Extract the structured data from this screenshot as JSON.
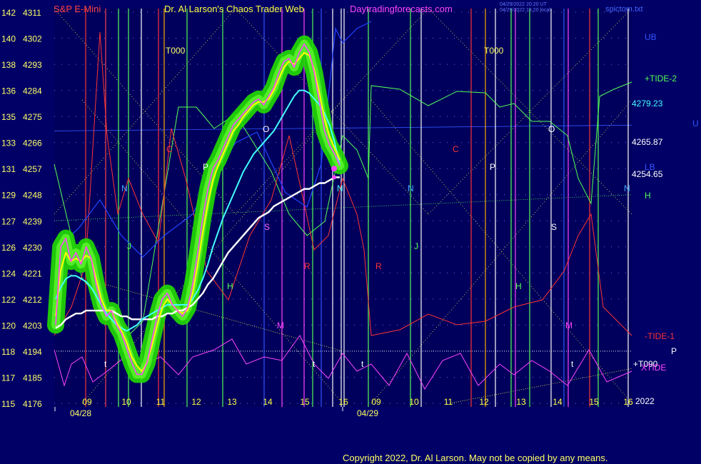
{
  "header": {
    "instrument": "S&P E-Mini",
    "site": "Dr. Al Larson's Chaos Trader Web",
    "url": "Daytradingforecasts.com",
    "stamp1": "04/29/2022 20:20 UT",
    "stamp2": "04/29/2022 15:20 local",
    "filename": "spictom.txt"
  },
  "footer": {
    "copyright": "Copyright 2022, Dr. Al Larson. May not be copied by any means."
  },
  "colors": {
    "background": "#000066",
    "plot_bg": "#00005c",
    "price_bar": "#ff44ff",
    "yellow_avg": "#ffff00",
    "cyan_avg": "#44ffff",
    "white_avg": "#ffffff",
    "glow": "#22dd00",
    "tide_plus": "#55ff55",
    "tide_minus": "#ff3333",
    "xtide": "#ff44ff",
    "blue_band": "#2244ff",
    "grid_dots": "#6666ff"
  },
  "chart_data": {
    "type": "line",
    "title": "S&P E-Mini",
    "dates": [
      "04/28",
      "04/29"
    ],
    "y_left_labels": [
      {
        "idx": "142",
        "price": "4311"
      },
      {
        "idx": "140",
        "price": "4302"
      },
      {
        "idx": "138",
        "price": "4293"
      },
      {
        "idx": "136",
        "price": "4284"
      },
      {
        "idx": "135",
        "price": "4275"
      },
      {
        "idx": "133",
        "price": "4266"
      },
      {
        "idx": "131",
        "price": "4257"
      },
      {
        "idx": "129",
        "price": "4248"
      },
      {
        "idx": "127",
        "price": "4239"
      },
      {
        "idx": "126",
        "price": "4230"
      },
      {
        "idx": "124",
        "price": "4221"
      },
      {
        "idx": "122",
        "price": "4212"
      },
      {
        "idx": "120",
        "price": "4203"
      },
      {
        "idx": "118",
        "price": "4194"
      },
      {
        "idx": "117",
        "price": "4185"
      },
      {
        "idx": "115",
        "price": "4176"
      }
    ],
    "ylim": [
      4176,
      4311
    ],
    "x_tick_labels": [
      "09",
      "10",
      "11",
      "12",
      "13",
      "14",
      "15",
      "16",
      "09",
      "10",
      "11",
      "12",
      "13",
      "14",
      "15",
      "16"
    ],
    "right_labels": [
      {
        "text": "UB",
        "color": "#3355ff"
      },
      {
        "text": "+TIDE-2",
        "color": "#55ff55"
      },
      {
        "text": "4279.23",
        "color": "#44ffff"
      },
      {
        "text": "U",
        "color": "#3355ff"
      },
      {
        "text": "4265.87",
        "color": "#ffffff"
      },
      {
        "text": "LB",
        "color": "#3355ff"
      },
      {
        "text": "4254.65",
        "color": "#ffffff"
      },
      {
        "text": "H",
        "color": "#55ff55"
      },
      {
        "text": "-TIDE-1",
        "color": "#ff3333"
      },
      {
        "text": "P",
        "color": "#ffffff"
      },
      {
        "text": "+T090",
        "color": "#ffffff"
      },
      {
        "text": "XTIDE",
        "color": "#ff44ff"
      },
      {
        "text": "2022",
        "color": "#ffffff"
      }
    ],
    "time_markers": [
      "T000",
      "T000"
    ],
    "annotations": [
      "N",
      "N",
      "N",
      "N",
      "P",
      "P",
      "O",
      "O",
      "S",
      "S",
      "J",
      "J",
      "H",
      "H",
      "M",
      "M",
      "R",
      "R",
      "C",
      "C",
      "t",
      "t",
      "t",
      "t"
    ],
    "series": [
      {
        "name": "price",
        "values": [
          4203,
          4230,
          4233,
          4225,
          4228,
          4224,
          4230,
          4226,
          4217,
          4210,
          4206,
          4208,
          4203,
          4200,
          4195,
          4190,
          4186,
          4186,
          4190,
          4198,
          4206,
          4212,
          4214,
          4210,
          4208,
          4206,
          4209,
          4217,
          4228,
          4240,
          4250,
          4257,
          4260,
          4264,
          4268,
          4272,
          4274,
          4276,
          4278,
          4280,
          4281,
          4279,
          4282,
          4285,
          4290,
          4294,
          4295,
          4292,
          4297,
          4300,
          4297,
          4290,
          4280,
          4270,
          4265,
          4262,
          4258
        ]
      },
      {
        "name": "fast-average",
        "values": [
          4206,
          4222,
          4228,
          4225,
          4226,
          4225,
          4227,
          4226,
          4219,
          4212,
          4208,
          4208,
          4204,
          4201,
          4197,
          4192,
          4189,
          4187,
          4190,
          4196,
          4203,
          4209,
          4212,
          4210,
          4208,
          4207,
          4208,
          4214,
          4224,
          4235,
          4245,
          4253,
          4258,
          4262,
          4266,
          4270,
          4272,
          4275,
          4277,
          4279,
          4280,
          4280,
          4281,
          4284,
          4288,
          4292,
          4294,
          4293,
          4295,
          4297,
          4296,
          4291,
          4283,
          4274,
          4268,
          4264,
          4260
        ]
      },
      {
        "name": "medium-average",
        "values": [
          4212,
          4216,
          4219,
          4220,
          4220,
          4219,
          4218,
          4216,
          4213,
          4210,
          4207,
          4205,
          4203,
          4202,
          4201,
          4202,
          4203,
          4205,
          4206,
          4207,
          4208,
          4209,
          4210,
          4210,
          4210,
          4210,
          4210,
          4212,
          4215,
          4219,
          4224,
          4230,
          4235,
          4240,
          4244,
          4248,
          4252,
          4256,
          4259,
          4262,
          4264,
          4266,
          4268,
          4270,
          4273,
          4276,
          4279,
          4282,
          4284,
          4284,
          4283,
          4281,
          4279,
          4276,
          4272,
          4266,
          4258
        ]
      },
      {
        "name": "slow-average",
        "values": [
          4202,
          4203,
          4205,
          4206,
          4207,
          4207,
          4208,
          4208,
          4208,
          4208,
          4208,
          4208,
          4207,
          4206,
          4206,
          4205,
          4205,
          4205,
          4205,
          4205,
          4206,
          4206,
          4207,
          4207,
          4208,
          4208,
          4209,
          4210,
          4212,
          4214,
          4217,
          4219,
          4222,
          4225,
          4228,
          4230,
          4232,
          4234,
          4236,
          4238,
          4240,
          4241,
          4242,
          4244,
          4245,
          4246,
          4247,
          4248,
          4249,
          4250,
          4250,
          4251,
          4252,
          4252,
          4253,
          4254,
          4254
        ]
      }
    ]
  }
}
